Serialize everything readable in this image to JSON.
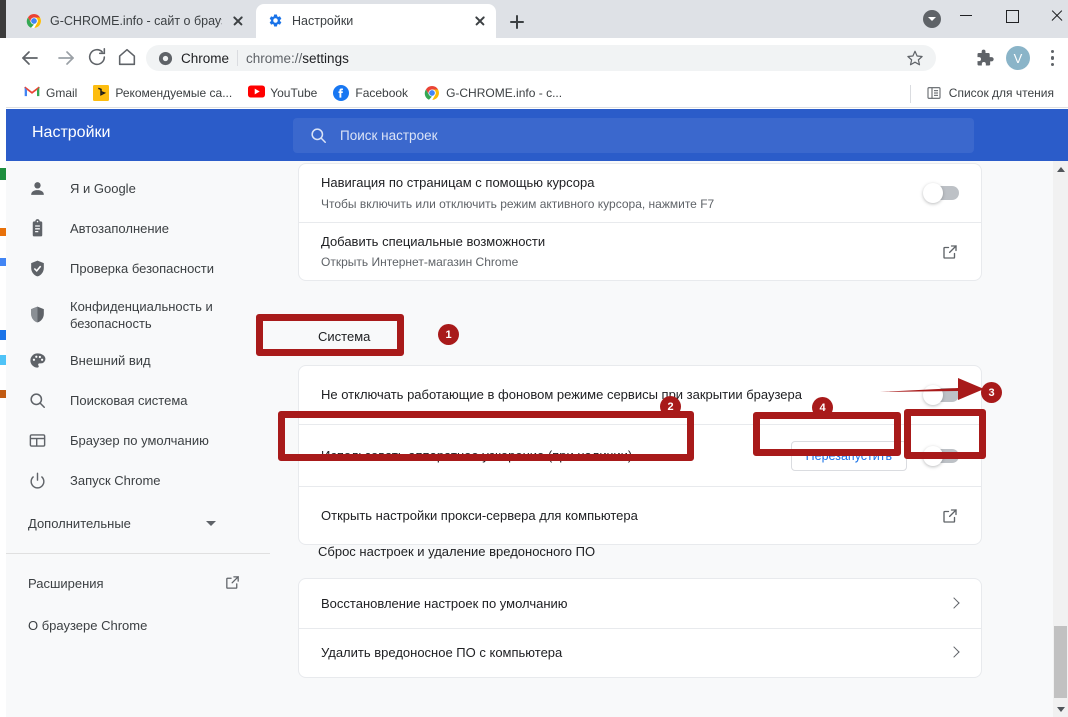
{
  "window": {
    "controls": {
      "minimize": "minimize-button",
      "maximize": "maximize-button",
      "close": "close-button"
    }
  },
  "tabs": [
    {
      "title": "G-CHROME.info - сайт о браузер",
      "icon": "chrome-icon",
      "active": false
    },
    {
      "title": "Настройки",
      "icon": "settings-gear-icon",
      "active": true
    }
  ],
  "toolbar": {
    "back": "back-icon",
    "forward": "forward-icon",
    "reload": "reload-icon",
    "home": "home-icon",
    "omnibox_label": "Chrome",
    "omnibox_url_prefix": "chrome://",
    "omnibox_url_path": "settings",
    "avatar_letter": "V"
  },
  "bookmarks": [
    {
      "label": "Gmail",
      "icon": "gmail-icon"
    },
    {
      "label": "Рекомендуемые са...",
      "icon": "bing-icon"
    },
    {
      "label": "YouTube",
      "icon": "youtube-icon"
    },
    {
      "label": "Facebook",
      "icon": "facebook-icon"
    },
    {
      "label": "G-CHROME.info - с...",
      "icon": "chrome-icon"
    }
  ],
  "reading_list": {
    "label": "Список для чтения",
    "icon": "reading-list-icon"
  },
  "settings_header": {
    "title": "Настройки",
    "search_placeholder": "Поиск настроек"
  },
  "sidebar": {
    "items": [
      {
        "label": "Я и Google",
        "icon": "person-icon"
      },
      {
        "label": "Автозаполнение",
        "icon": "clipboard-icon"
      },
      {
        "label": "Проверка безопасности",
        "icon": "shield-check-icon"
      },
      {
        "label": "Конфиденциальность и безопасность",
        "icon": "shield-icon"
      },
      {
        "label": "Внешний вид",
        "icon": "palette-icon"
      },
      {
        "label": "Поисковая система",
        "icon": "search-icon"
      },
      {
        "label": "Браузер по умолчанию",
        "icon": "browser-window-icon"
      },
      {
        "label": "Запуск Chrome",
        "icon": "power-icon"
      }
    ],
    "advanced": {
      "label": "Дополнительные",
      "icon": "chevron-down-icon"
    },
    "extensions": {
      "label": "Расширения",
      "icon": "open-in-new-icon"
    },
    "about": {
      "label": "О браузере Chrome"
    }
  },
  "main": {
    "accessibility_rows": [
      {
        "title": "Навигация по страницам с помощью курсора",
        "subtitle": "Чтобы включить или отключить режим активного курсора, нажмите F7",
        "control": "toggle-off"
      },
      {
        "title": "Добавить специальные возможности",
        "subtitle": "Открыть Интернет-магазин Chrome",
        "control": "open-in-new-icon"
      }
    ],
    "system_heading": "Система",
    "system_rows": [
      {
        "title": "Не отключать работающие в фоновом режиме сервисы при закрытии браузера",
        "control": "toggle-off"
      },
      {
        "title": "Использовать аппаратное ускорение (при наличии)",
        "button": "Перезапустить",
        "control": "toggle-off"
      },
      {
        "title": "Открыть настройки прокси-сервера для компьютера",
        "control": "open-in-new-icon"
      }
    ],
    "reset_heading": "Сброс настроек и удаление вредоносного ПО",
    "reset_rows": [
      {
        "title": "Восстановление настроек по умолчанию",
        "control": "chevron-right-icon"
      },
      {
        "title": "Удалить вредоносное ПО с компьютера",
        "control": "chevron-right-icon"
      }
    ]
  },
  "annotations": {
    "color": "#a81a1a",
    "badges": [
      {
        "number": "1",
        "target": "system-heading"
      },
      {
        "number": "2",
        "target": "hardware-acceleration-row"
      },
      {
        "number": "3",
        "target": "hardware-acceleration-toggle"
      },
      {
        "number": "4",
        "target": "restart-button"
      }
    ]
  }
}
